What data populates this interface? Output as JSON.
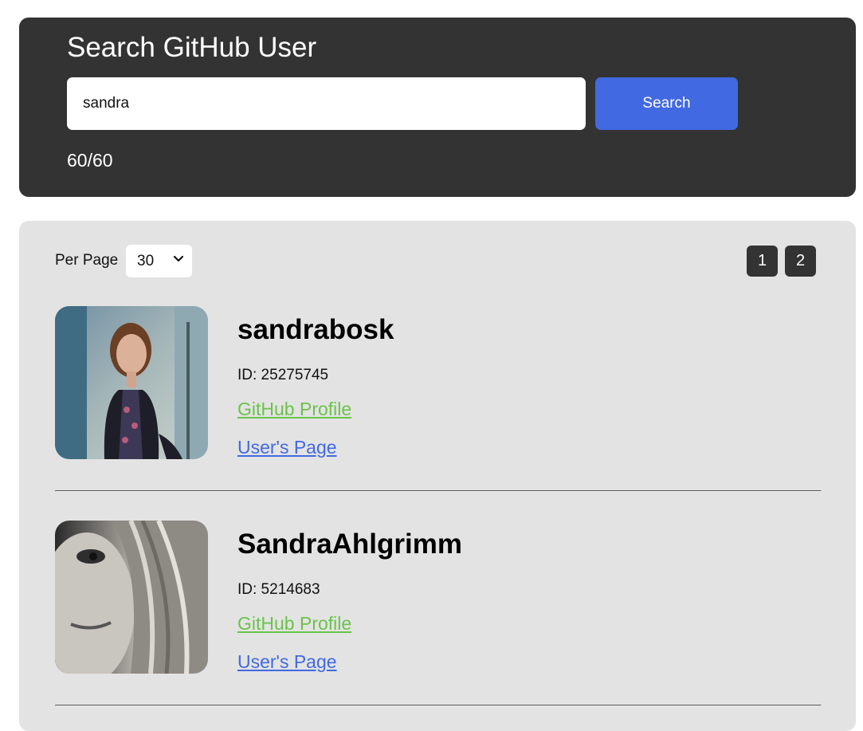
{
  "search": {
    "title": "Search GitHub User",
    "query": "sandra",
    "button_label": "Search",
    "rate_limit": "60/60"
  },
  "results": {
    "per_page_label": "Per Page",
    "per_page_value": "30",
    "pages": [
      "1",
      "2"
    ],
    "users": [
      {
        "login": "sandrabosk",
        "id_text": "ID: 25275745",
        "github_link": "GitHub Profile",
        "page_link": "User's Page"
      },
      {
        "login": "SandraAhlgrimm",
        "id_text": "ID: 5214683",
        "github_link": "GitHub Profile",
        "page_link": "User's Page"
      }
    ]
  },
  "colors": {
    "panel_dark": "#333333",
    "panel_light": "#e3e3e3",
    "accent_blue": "#4169e1",
    "link_green": "#6bc34a"
  },
  "icons": {
    "select_arrow": "chevron-down-icon"
  }
}
